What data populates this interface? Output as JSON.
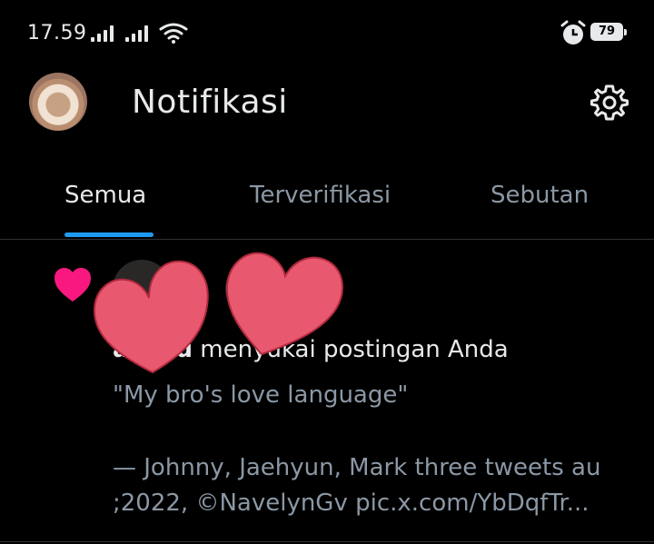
{
  "status_bar": {
    "time": "17.59",
    "battery": "79",
    "icons": [
      "signal-icon",
      "signal-icon",
      "wifi-icon",
      "alarm-icon",
      "battery-icon"
    ]
  },
  "header": {
    "title": "Notifikasi",
    "avatar_icon": "avatar",
    "settings_icon": "gear-icon"
  },
  "tabs": [
    {
      "label": "Semua",
      "active": true
    },
    {
      "label": "Terverifikasi",
      "active": false
    },
    {
      "label": "Sebutan",
      "active": false
    }
  ],
  "notification": {
    "icon": "heart-icon",
    "username": "a    lusu",
    "action": "menyukai postingan Anda",
    "quote_lines": [
      "\"My bro's love language\"",
      "— Johnny, Jaehyun, Mark three tweets au",
      ";2022, ©NavelynGv pic.x.com/YbDqfTr..."
    ]
  },
  "colors": {
    "accent": "#1d9bf0",
    "like": "#f91880",
    "sticker": "#e8596f",
    "muted": "#8b98a5",
    "text": "#e7e9ea"
  }
}
